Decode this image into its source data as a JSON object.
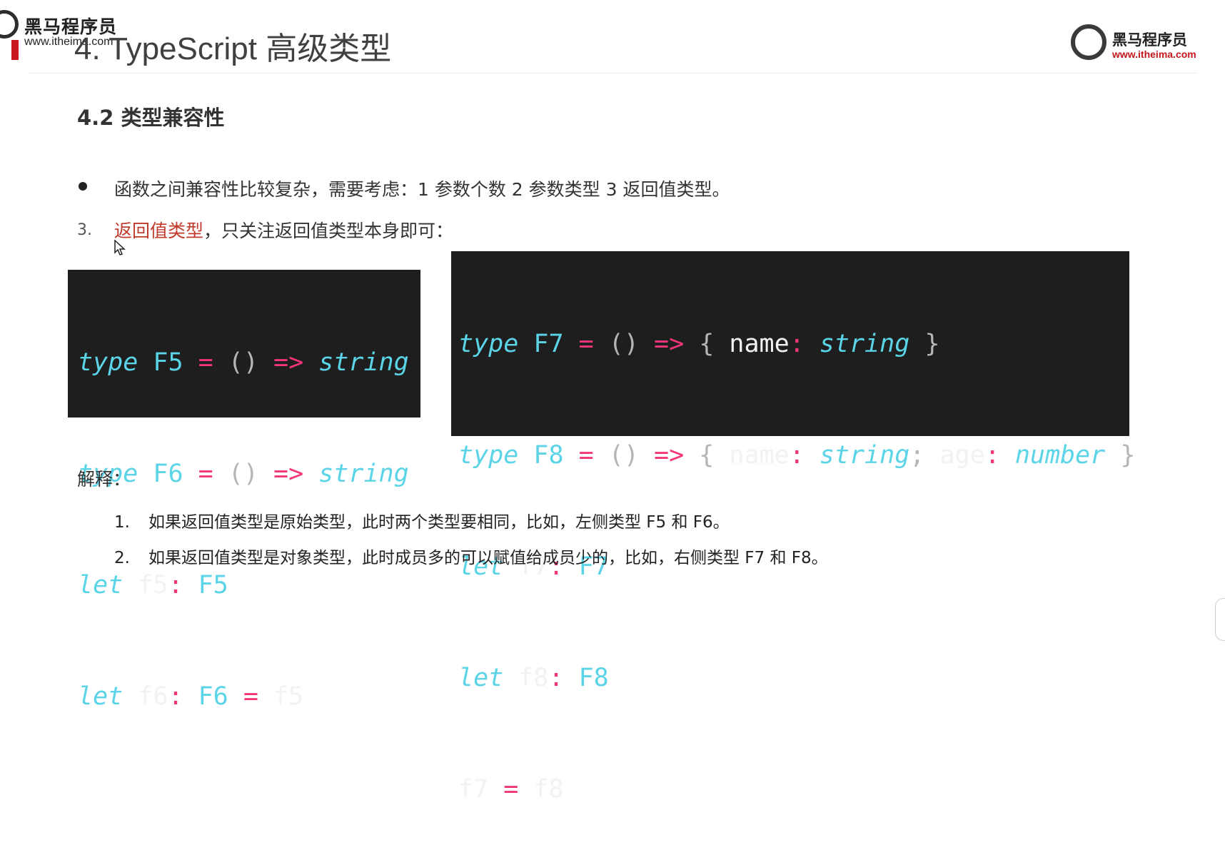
{
  "watermark": {
    "name": "黑马程序员",
    "url": "www.itheima.com"
  },
  "page_title": "4. TypeScript 高级类型",
  "logo": {
    "name": "黑马程序员",
    "url": "www.itheima.com"
  },
  "section_heading": "4.2 类型兼容性",
  "bullet_text": "函数之间兼容性比较复杂，需要考虑：1 参数个数 2 参数类型 3 返回值类型。",
  "item3": {
    "number": "3.",
    "highlight": "返回值类型",
    "rest": "，只关注返回值类型本身即可："
  },
  "code_left": {
    "line1": {
      "kw": "type",
      "name": "F5",
      "eq": "=",
      "parens": "()",
      "arrow": "=>",
      "ret": "string"
    },
    "line2": {
      "kw": "type",
      "name": "F6",
      "eq": "=",
      "parens": "()",
      "arrow": "=>",
      "ret": "string"
    },
    "line3": {
      "kw": "let",
      "var": "f5",
      "colon": ":",
      "type": "F5"
    },
    "line4": {
      "kw": "let",
      "var": "f6",
      "colon": ":",
      "type": "F6",
      "eq": "=",
      "value": "f5"
    }
  },
  "code_right": {
    "line1": {
      "kw": "type",
      "name": "F7",
      "eq": "=",
      "parens": "()",
      "arrow": "=>",
      "open": "{",
      "prop": "name",
      "colon": ":",
      "ptype": "string",
      "close": "}"
    },
    "line2": {
      "kw": "type",
      "name": "F8",
      "eq": "=",
      "parens": "()",
      "arrow": "=>",
      "open": "{",
      "prop1": "name",
      "colon1": ":",
      "ptype1": "string",
      "semi": ";",
      "prop2": "age",
      "colon2": ":",
      "ptype2": "number",
      "close": "}"
    },
    "line3": {
      "kw": "let",
      "var": "f7",
      "colon": ":",
      "type": "F7"
    },
    "line4": {
      "kw": "let",
      "var": "f8",
      "colon": ":",
      "type": "F8"
    },
    "line5": {
      "lhs": "f7",
      "eq": "=",
      "rhs": "f8"
    }
  },
  "explain_label": "解释：",
  "explanations": [
    {
      "num": "1.",
      "text": "如果返回值类型是原始类型，此时两个类型要相同，比如，左侧类型 F5 和 F6。"
    },
    {
      "num": "2.",
      "text": "如果返回值类型是对象类型，此时成员多的可以赋值给成员少的，比如，右侧类型 F7 和 F8。"
    }
  ]
}
